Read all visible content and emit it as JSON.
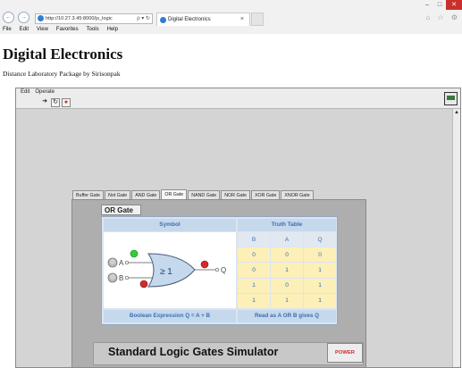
{
  "browser": {
    "url": "http://10.27.3.45:8000/js_logic",
    "address_tools": "ρ ▾ ↻",
    "tab_title": "Digital Electronics",
    "tab_close": "×",
    "back_glyph": "←",
    "forward_glyph": "→",
    "window_buttons": {
      "minimize": "–",
      "maximize": "□",
      "close": "✕"
    },
    "right_icons": "⌂ ☆ ⚙",
    "menu": [
      "File",
      "Edit",
      "View",
      "Favorites",
      "Tools",
      "Help"
    ]
  },
  "page": {
    "title": "Digital Electronics",
    "subtitle": "Distance Laboratory Package by Sirisonpak"
  },
  "vi": {
    "menu": [
      "Edit",
      "Operate"
    ],
    "toolbar": {
      "run": "➜",
      "run_continuous": "↻",
      "abort": "●"
    },
    "scroll_up": "▲"
  },
  "gate_tabs": [
    "Buffer Gate",
    "Not Gate",
    "AND Gate",
    "OR Gate",
    "NAND Gate",
    "NOR Gate",
    "XOR Gate",
    "XNOR Gate"
  ],
  "active_tab": "OR Gate",
  "panel": {
    "heading": "OR Gate",
    "symbol_header": "Symbol",
    "truth_header": "Truth Table",
    "gate_symbol": "≥ 1",
    "input_a": "A",
    "input_b": "B",
    "output_q": "Q",
    "led_a_color": "#2fcf3a",
    "led_b_color": "#d42a2a",
    "led_q_color": "#d42a2a",
    "truth_table": {
      "columns": [
        "B",
        "A",
        "Q"
      ],
      "rows": [
        [
          "0",
          "0",
          "0"
        ],
        [
          "0",
          "1",
          "1"
        ],
        [
          "1",
          "0",
          "1"
        ],
        [
          "1",
          "1",
          "1"
        ]
      ]
    },
    "boolean_expression": "Boolean Expression Q = A + B",
    "read_as": "Read as A OR B gives Q"
  },
  "footer": {
    "title": "Standard Logic Gates Simulator",
    "power_label": "POWER"
  }
}
